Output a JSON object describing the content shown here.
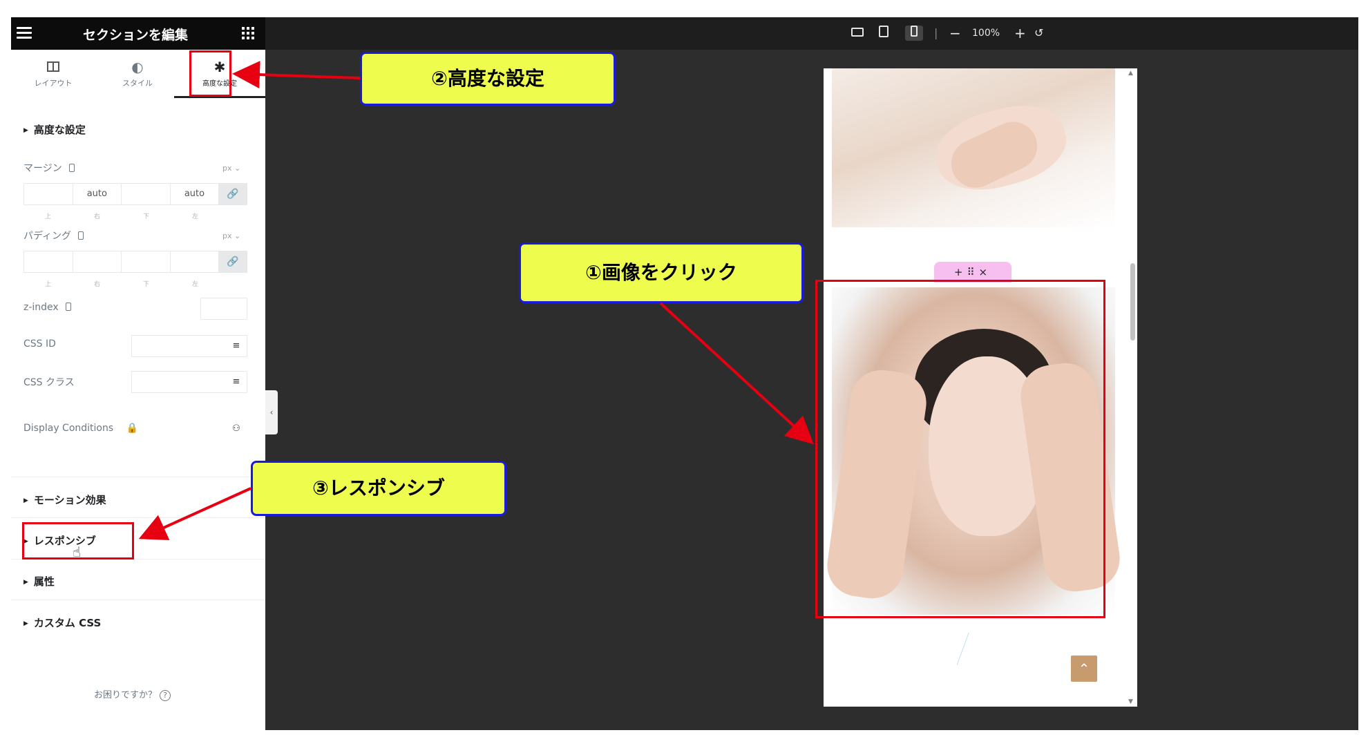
{
  "sidebar": {
    "title": "セクションを編集",
    "tabs": [
      {
        "label": "レイアウト",
        "icon": "columns-icon"
      },
      {
        "label": "スタイル",
        "icon": "half-circle-icon"
      },
      {
        "label": "高度な設定",
        "icon": "gear-icon"
      }
    ],
    "advanced_section": "高度な設定",
    "margin": {
      "label": "マージン",
      "unit": "px",
      "top": "",
      "right": "auto",
      "bottom": "",
      "left": "auto"
    },
    "padding": {
      "label": "パディング",
      "unit": "px",
      "top": "",
      "right": "",
      "bottom": "",
      "left": ""
    },
    "side_labels": [
      "上",
      "右",
      "下",
      "左"
    ],
    "zindex_label": "z-index",
    "cssid_label": "CSS ID",
    "cssclass_label": "CSS クラス",
    "display_conditions_label": "Display Conditions",
    "sections": [
      "モーション効果",
      "レスポンシブ",
      "属性",
      "カスタム CSS"
    ],
    "help_text": "お困りですか？"
  },
  "topbar": {
    "zoom": "100%",
    "icons": [
      "desktop-icon",
      "tablet-icon",
      "mobile-icon",
      "minus-icon",
      "plus-icon",
      "undo-icon"
    ]
  },
  "preview": {
    "handle_icons": [
      "+",
      "⠿",
      "×"
    ]
  },
  "annotations": {
    "step1": "①画像をクリック",
    "step2": "②高度な設定",
    "step3": "③レスポンシブ"
  },
  "colors": {
    "callout_bg": "#eefc4e",
    "callout_border": "#1a1adc",
    "highlight_red": "#e60012",
    "handle_pink": "#f6bff0"
  }
}
